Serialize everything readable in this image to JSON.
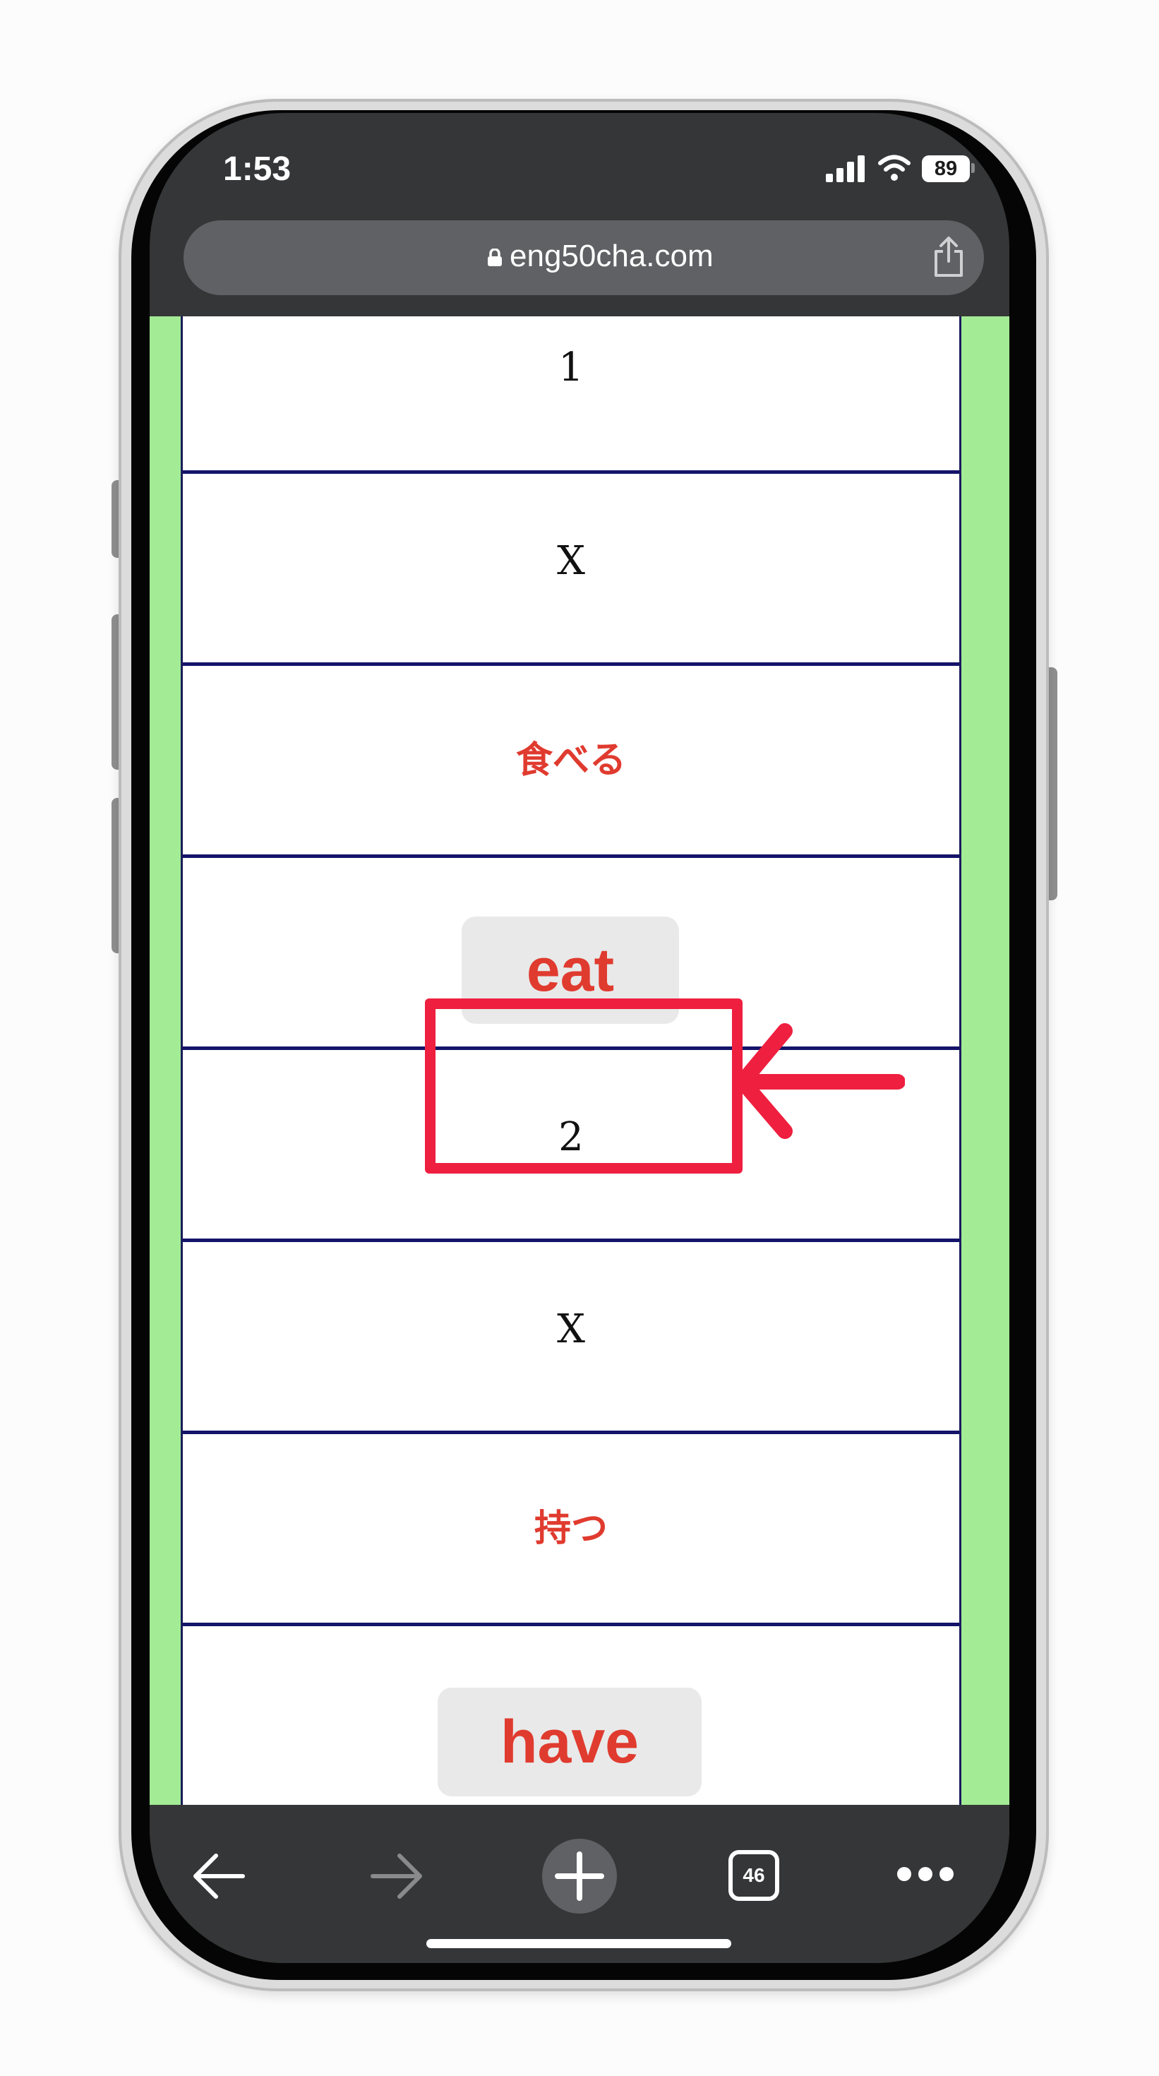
{
  "status_bar": {
    "time": "1:53",
    "battery": "89"
  },
  "address_bar": {
    "url": "eng50cha.com"
  },
  "rows": [
    {
      "text": "1",
      "kind": "number"
    },
    {
      "text": "X",
      "kind": "number"
    },
    {
      "text": "食べる",
      "kind": "japanese"
    },
    {
      "text": "eat",
      "kind": "word-button"
    },
    {
      "text": "2",
      "kind": "number"
    },
    {
      "text": "X",
      "kind": "number"
    },
    {
      "text": "持つ",
      "kind": "japanese"
    },
    {
      "text": "have",
      "kind": "word-button"
    }
  ],
  "toolbar": {
    "tab_count": "46"
  },
  "colors": {
    "page_background": "#a3eb95",
    "row_divider": "#14146a",
    "japanese_text": "#e03b2f",
    "word_text": "#e03b2f",
    "highlight": "#ee1f3f",
    "browser_chrome": "#353637"
  },
  "icons": [
    "lock-icon",
    "share-icon",
    "back-arrow-icon",
    "forward-arrow-icon",
    "new-tab-plus-icon",
    "tabs-icon",
    "more-icon",
    "signal-icon",
    "wifi-icon",
    "battery-icon"
  ]
}
